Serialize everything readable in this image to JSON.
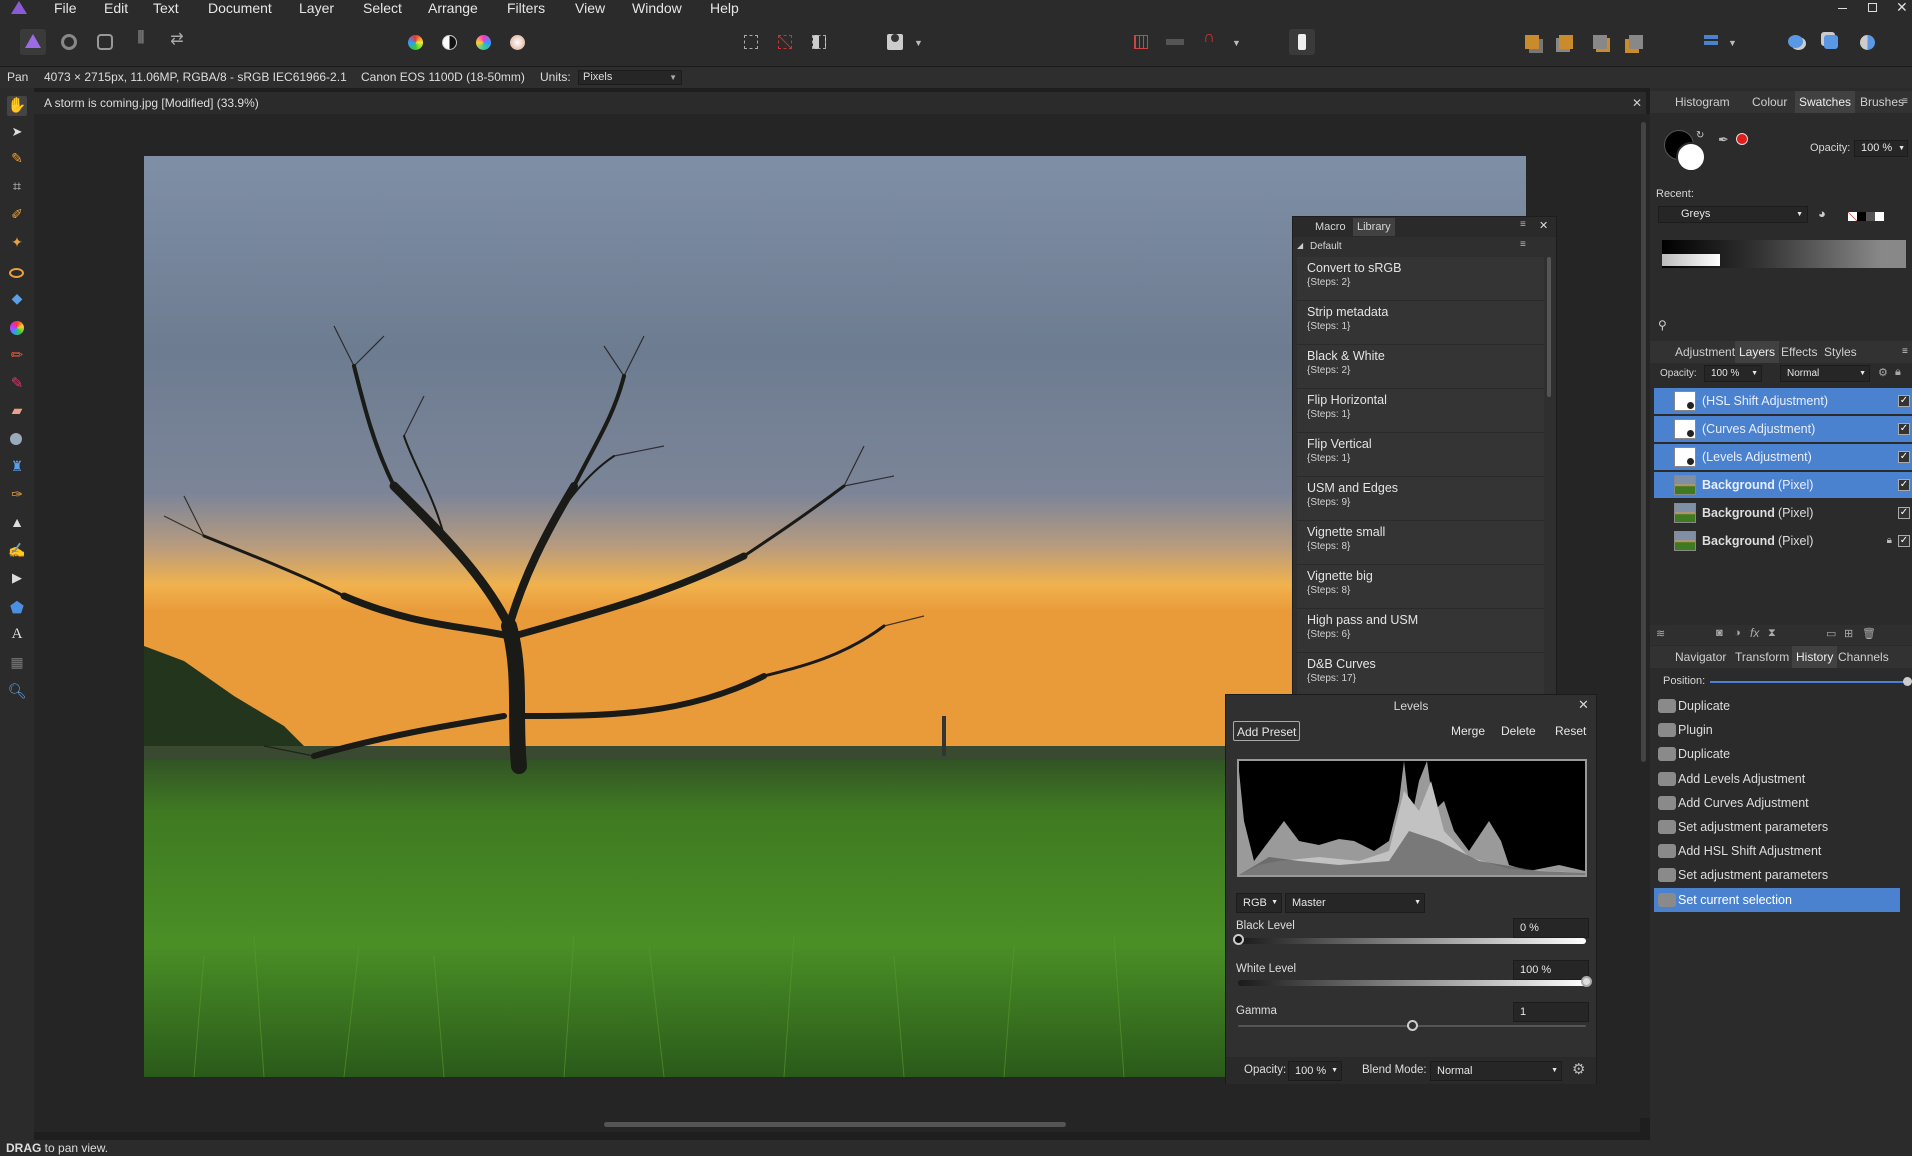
{
  "menu": [
    "File",
    "Edit",
    "Text",
    "Document",
    "Layer",
    "Select",
    "Arrange",
    "Filters",
    "View",
    "Window",
    "Help"
  ],
  "context": {
    "tool": "Pan",
    "doc_info": "4073 × 2715px, 11.06MP, RGBA/8 - sRGB IEC61966-2.1",
    "camera": "Canon EOS 1100D (18-50mm)",
    "units_label": "Units:",
    "units_value": "Pixels"
  },
  "document": {
    "title": "A storm is coming.jpg [Modified] (33.9%)"
  },
  "status": {
    "bold": "DRAG",
    "text": " to pan view."
  },
  "top_panel": {
    "tabs": [
      "Histogram",
      "Colour",
      "Swatches",
      "Brushes"
    ],
    "active_tab": "Swatches",
    "opacity_label": "Opacity:",
    "opacity_value": "100 %",
    "recent_label": "Recent:",
    "palette": "Greys"
  },
  "layers_panel": {
    "tabs": [
      "Adjustment",
      "Layers",
      "Effects",
      "Styles"
    ],
    "active_tab": "Layers",
    "opacity_label": "Opacity:",
    "opacity_value": "100 %",
    "blend": "Normal",
    "layers": [
      {
        "name": "(HSL Shift Adjustment)",
        "selected": true
      },
      {
        "name": "(Curves Adjustment)",
        "selected": true
      },
      {
        "name": "(Levels Adjustment)",
        "selected": true
      },
      {
        "name": "Background",
        "suffix": "(Pixel)",
        "selected": true
      },
      {
        "name": "Background",
        "suffix": "(Pixel)",
        "selected": false
      },
      {
        "name": "Background",
        "suffix": "(Pixel)",
        "selected": false
      }
    ]
  },
  "history_panel": {
    "tabs": [
      "Navigator",
      "Transform",
      "History",
      "Channels"
    ],
    "active_tab": "History",
    "position_label": "Position:",
    "items": [
      "Duplicate",
      "Plugin",
      "Duplicate",
      "Add Levels Adjustment",
      "Add Curves Adjustment",
      "Set adjustment parameters",
      "Add HSL Shift Adjustment",
      "Set adjustment parameters",
      "Set current selection"
    ],
    "selected_index": 8
  },
  "macro_panel": {
    "tabs": [
      "Macro",
      "Library"
    ],
    "active_tab": "Library",
    "category": "Default",
    "items": [
      {
        "title": "Convert to sRGB",
        "steps": "{Steps: 2}"
      },
      {
        "title": "Strip metadata",
        "steps": "{Steps: 1}"
      },
      {
        "title": "Black & White",
        "steps": "{Steps: 2}"
      },
      {
        "title": "Flip Horizontal",
        "steps": "{Steps: 1}"
      },
      {
        "title": "Flip Vertical",
        "steps": "{Steps: 1}"
      },
      {
        "title": "USM and Edges",
        "steps": "{Steps: 9}"
      },
      {
        "title": "Vignette small",
        "steps": "{Steps: 8}"
      },
      {
        "title": "Vignette big",
        "steps": "{Steps: 8}"
      },
      {
        "title": "High pass and USM",
        "steps": "{Steps: 6}"
      },
      {
        "title": "D&B Curves",
        "steps": "{Steps: 17}"
      }
    ]
  },
  "levels": {
    "title": "Levels",
    "add_preset": "Add Preset",
    "merge": "Merge",
    "delete": "Delete",
    "reset": "Reset",
    "channel_mode": "RGB",
    "channel": "Master",
    "black_label": "Black Level",
    "black_value": "0 %",
    "white_label": "White Level",
    "white_value": "100 %",
    "gamma_label": "Gamma",
    "gamma_value": "1",
    "opacity_label": "Opacity:",
    "opacity_value": "100 %",
    "blend_label": "Blend Mode:",
    "blend_value": "Normal",
    "black_level": 0,
    "white_level": 1.0,
    "gamma_position": 0.5
  }
}
